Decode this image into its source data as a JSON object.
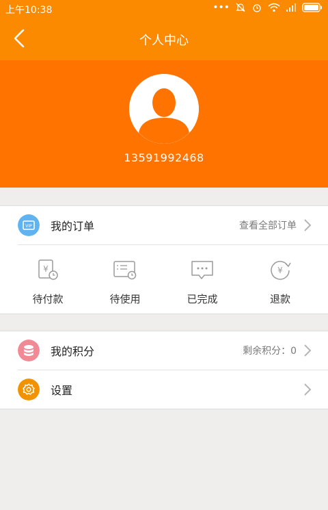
{
  "status_bar": {
    "time": "上午10:38"
  },
  "header": {
    "title": "个人中心"
  },
  "profile": {
    "phone": "13591992468"
  },
  "orders_card": {
    "title": "我的订单",
    "view_all": "查看全部订单",
    "items": [
      {
        "label": "待付款",
        "icon": "pending-payment-icon"
      },
      {
        "label": "待使用",
        "icon": "ticket-icon"
      },
      {
        "label": "已完成",
        "icon": "chat-bubble-icon"
      },
      {
        "label": "退款",
        "icon": "refund-icon"
      }
    ]
  },
  "points": {
    "title": "我的积分",
    "remaining": "剩余积分：0"
  },
  "settings": {
    "title": "设置"
  },
  "colors": {
    "orange_header": "#fc8a00",
    "orange_profile": "#ff7300",
    "order_icon_blue": "#5fb3f0",
    "points_icon_pink": "#f28a95",
    "settings_icon_orange": "#f39200"
  }
}
